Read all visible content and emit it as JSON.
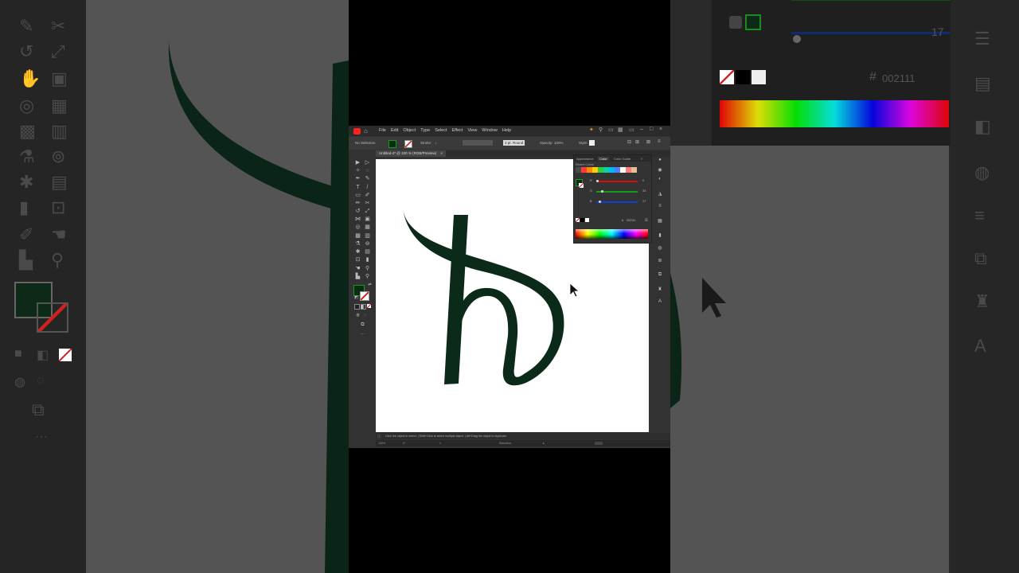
{
  "app": {
    "menu": [
      "File",
      "Edit",
      "Object",
      "Type",
      "Select",
      "Effect",
      "View",
      "Window",
      "Help"
    ],
    "control_bar": {
      "selection": "No Selection",
      "stroke_label": "Stroke:",
      "stroke_value": "↕",
      "brush": "3 pt. Round",
      "opacity_label": "Opacity:",
      "opacity_value": "100%",
      "style_label": "Style:"
    },
    "document_tab": "Untitled-4* @ 100 % (RGB/Preview)",
    "tab_close": "×",
    "status_text": "Click the object to select. | Shift+Click to select multiple object. | Alt+Drag the object to duplicate.",
    "bottom": {
      "zoom": "100%",
      "rotation": "0°",
      "artboard": "1",
      "mode": "Selection"
    },
    "colors": {
      "fill": "#0d2a18",
      "letter": "#0b2a1a",
      "accent": "#ff2020"
    }
  },
  "color_panel": {
    "tabs": [
      "Appearance",
      "Color",
      "Color Guide"
    ],
    "recent_label": "Recent Colors",
    "recent_swatches": [
      "#4a4a4a",
      "#ff3b3b",
      "#ff8a00",
      "#ffd000",
      "#2ecc40",
      "#0dd2a0",
      "#00b7ff",
      "#4f7dff",
      "#ffffff",
      "#ff7a7a",
      "#e7c09a"
    ],
    "r_label": "R",
    "r_value": "0",
    "g_label": "G",
    "g_value": "33",
    "b_label": "B",
    "b_value": "17",
    "hex_label": "#",
    "hex_value": "002111",
    "channel_colors": {
      "r": "#d01010",
      "g": "#13a013",
      "b": "#1040d0"
    }
  },
  "background_right": {
    "value_17": "17",
    "hex_value": "002111",
    "hex_label": "#"
  }
}
